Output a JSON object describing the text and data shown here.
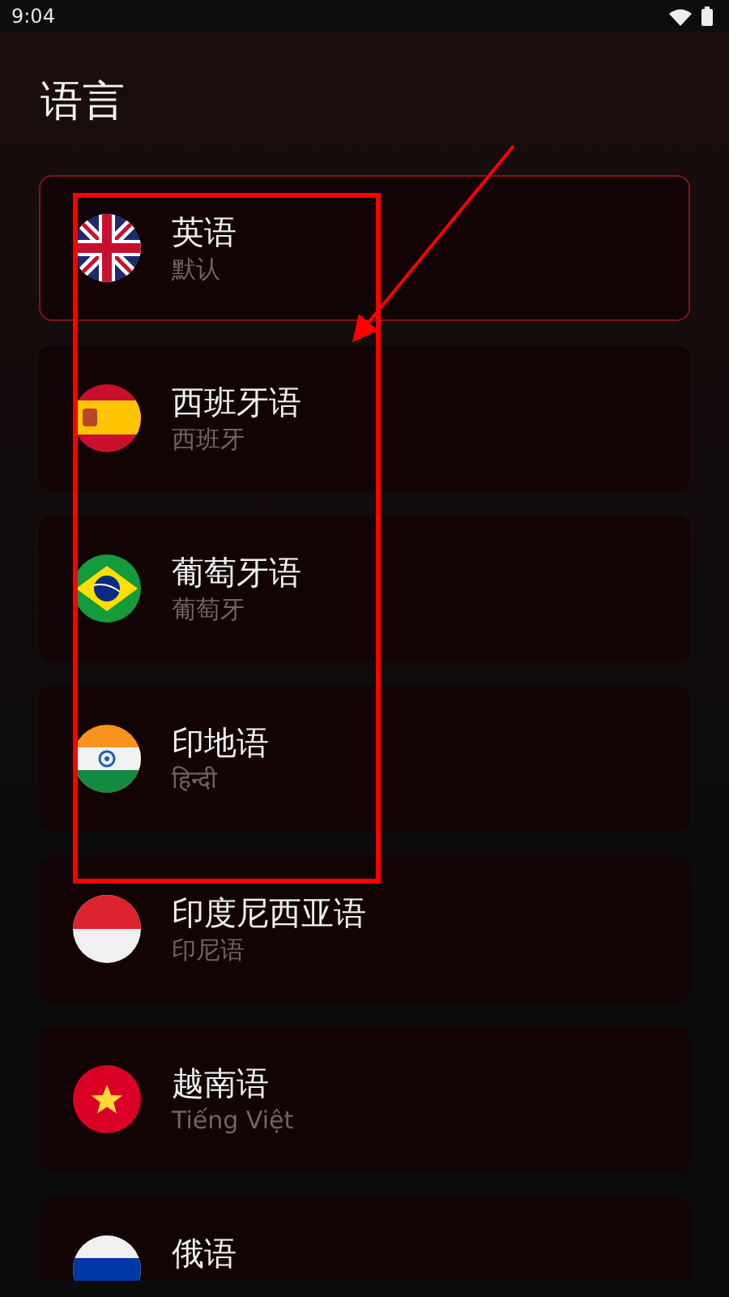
{
  "status_bar": {
    "time": "9:04"
  },
  "title": "语言",
  "languages": [
    {
      "name": "英语",
      "subtitle": "默认",
      "kind": "uk",
      "selected": true
    },
    {
      "name": "西班牙语",
      "subtitle": "西班牙",
      "kind": "es",
      "selected": false
    },
    {
      "name": "葡萄牙语",
      "subtitle": "葡萄牙",
      "kind": "br",
      "selected": false
    },
    {
      "name": "印地语",
      "subtitle": "हिन्दी",
      "kind": "in",
      "selected": false
    },
    {
      "name": "印度尼西亚语",
      "subtitle": "印尼语",
      "kind": "id",
      "selected": false
    },
    {
      "name": "越南语",
      "subtitle": "Tiếng Việt",
      "kind": "vn",
      "selected": false
    },
    {
      "name": "俄语",
      "kind": "ru",
      "selected": false
    }
  ]
}
